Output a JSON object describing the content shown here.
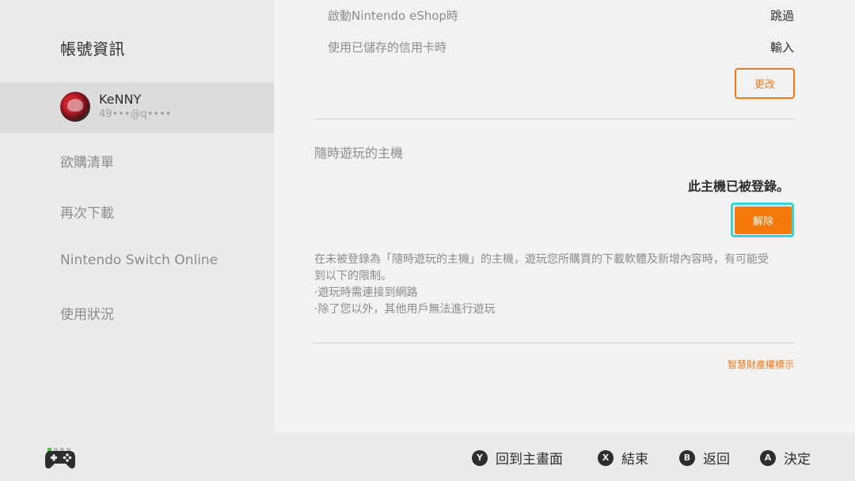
{
  "sidebar": {
    "title": "帳號資訊",
    "user": {
      "name": "KeNNY",
      "email": "49•••@q••••"
    },
    "items": [
      {
        "label": "欲購清單"
      },
      {
        "label": "再次下載"
      },
      {
        "label": "Nintendo Switch Online"
      },
      {
        "label": "使用狀況"
      }
    ]
  },
  "main": {
    "rows": [
      {
        "label": "啟動Nintendo eShop時",
        "value": "跳過"
      },
      {
        "label": "使用已儲存的信用卡時",
        "value": "輸入"
      }
    ],
    "change_button": "更改",
    "primary_console": {
      "title": "隨時遊玩的主機",
      "status": "此主機已被登錄。",
      "deregister_button": "解除",
      "description": [
        "在未被登錄為「隨時遊玩的主機」的主機，遊玩您所購買的下載軟體及新增內容時，有可能受",
        "到以下的限制。",
        "·遊玩時需連接到網路",
        "·除了您以外，其他用戶無法進行遊玩"
      ]
    },
    "ip_notice_link": "智慧財產權標示"
  },
  "footer": {
    "icon": "controller-icon",
    "actions": [
      {
        "button": "Y",
        "label": "回到主畫面"
      },
      {
        "button": "X",
        "label": "結束"
      },
      {
        "button": "B",
        "label": "返回"
      },
      {
        "button": "A",
        "label": "決定"
      }
    ]
  },
  "colors": {
    "accent": "#f57a0a",
    "focus": "#3cd3cd",
    "controller_active": "#4fc73c"
  }
}
